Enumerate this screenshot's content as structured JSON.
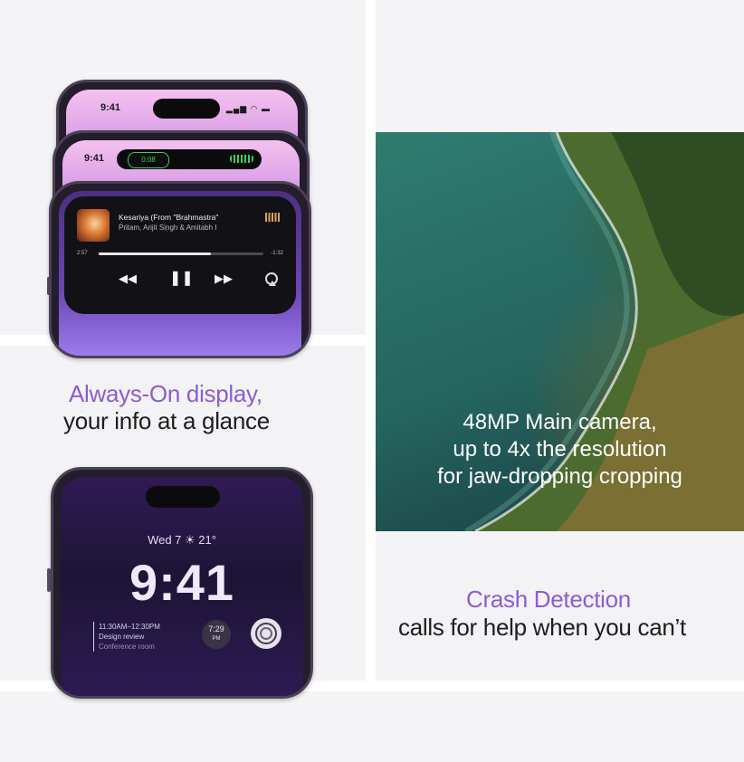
{
  "always_on": {
    "headline_line1": "Always-On display,",
    "headline_line2": "your info at a glance"
  },
  "phone_top": {
    "status_time": "9:41",
    "call_timer": "0:08",
    "status_time_2": "9:41"
  },
  "now_playing": {
    "title": "Kesariya (From \"Brahmastra\"",
    "artist": "Pritam, Arijit Singh & Amitabh I",
    "elapsed": "2:57",
    "remaining": "-1:32",
    "progress_fraction": 0.68,
    "rewind_glyph": "◀◀",
    "pause_glyph": "❚❚",
    "forward_glyph": "▶▶"
  },
  "lock_screen": {
    "date": "Wed 7 ☀ 21°",
    "time": "9:41",
    "event_time": "11:30AM–12:30PM",
    "event_title": "Design review",
    "event_location": "Conference room",
    "clock_widget_time": "7:29",
    "clock_widget_period": "PM"
  },
  "camera": {
    "line1": "48MP Main camera,",
    "line2": "up to 4x the resolution",
    "line3": "for jaw-dropping cropping"
  },
  "crash": {
    "headline_line1": "Crash Detection",
    "headline_line2": "calls for help when you can’t"
  },
  "colors": {
    "accent_purple": "#8d5bd6",
    "text_dark": "#1d1d1f",
    "page_bg": "#f4f4f6"
  }
}
